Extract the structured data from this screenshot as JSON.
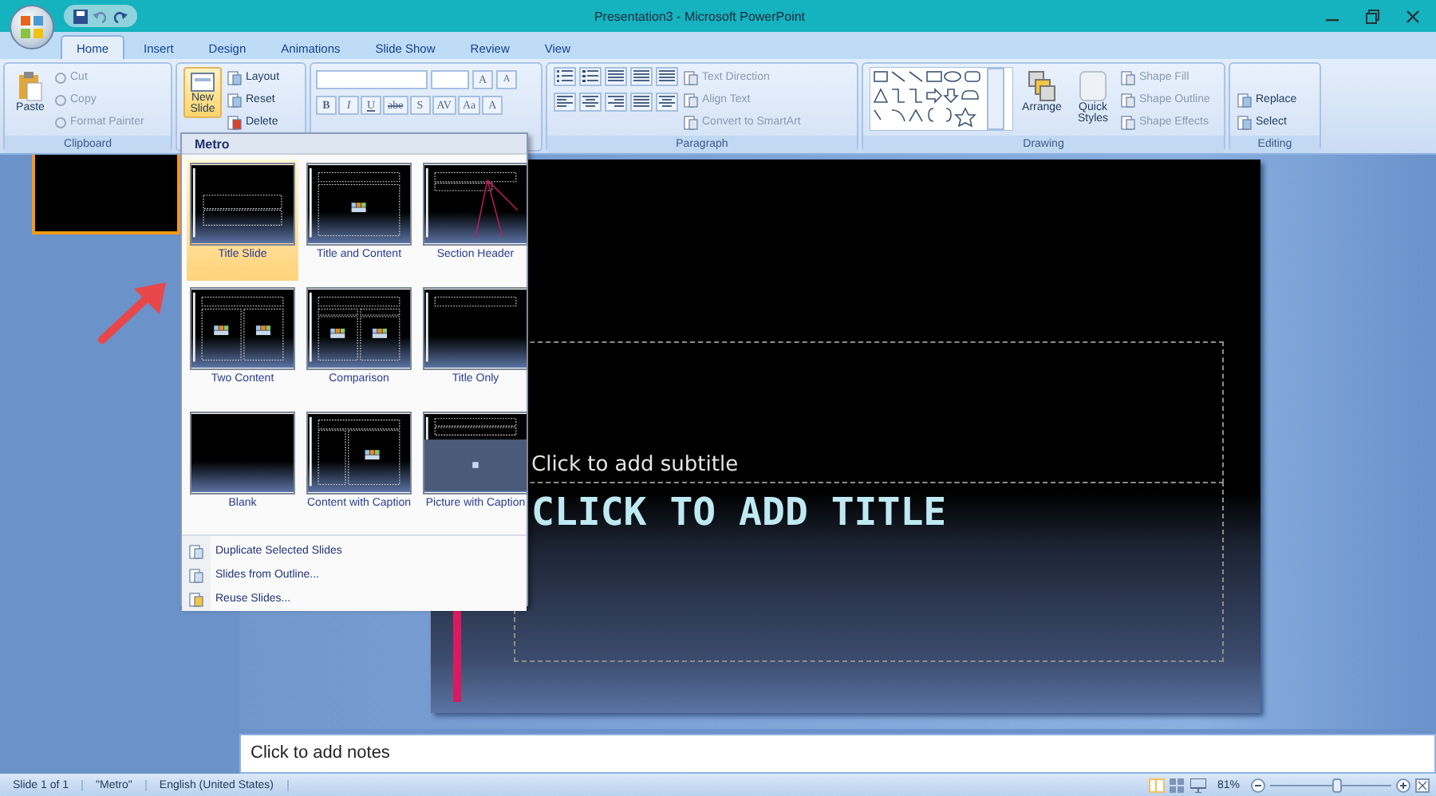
{
  "window": {
    "title": "Presentation3 - Microsoft PowerPoint"
  },
  "tabs": [
    {
      "label": "Home",
      "selected": true
    },
    {
      "label": "Insert",
      "selected": false
    },
    {
      "label": "Design",
      "selected": false
    },
    {
      "label": "Animations",
      "selected": false
    },
    {
      "label": "Slide Show",
      "selected": false
    },
    {
      "label": "Review",
      "selected": false
    },
    {
      "label": "View",
      "selected": false
    }
  ],
  "ribbon": {
    "clipboard": {
      "label": "Clipboard",
      "paste": "Paste",
      "items": [
        "Cut",
        "Copy",
        "Format Painter"
      ]
    },
    "slides": {
      "new_slide": "New Slide",
      "items": [
        "Layout",
        "Reset",
        "Delete"
      ]
    },
    "font": {
      "grow": "A",
      "shrink": "A",
      "format_buttons": [
        "B",
        "I",
        "U",
        "abe",
        "S",
        "AV",
        "Aa",
        "A"
      ]
    },
    "paragraph": {
      "label": "Paragraph",
      "items": [
        "Text Direction",
        "Align Text",
        "Convert to SmartArt"
      ]
    },
    "drawing": {
      "label": "Drawing",
      "arrange": "Arrange",
      "quick_styles": "Quick Styles",
      "items": [
        "Shape Fill",
        "Shape Outline",
        "Shape Effects"
      ]
    },
    "editing": {
      "label": "Editing",
      "items": [
        "Replace",
        "Select"
      ]
    }
  },
  "slide": {
    "subtitle": "Click to add subtitle",
    "title": "CLICK TO ADD TITLE"
  },
  "notes": {
    "text": "Click to add notes"
  },
  "layout_menu": {
    "theme": "Metro",
    "layouts": [
      {
        "label": "Title Slide",
        "kind": "title",
        "selected": true
      },
      {
        "label": "Title and Content",
        "kind": "content",
        "selected": false
      },
      {
        "label": "Section Header",
        "kind": "section",
        "selected": false
      },
      {
        "label": "Two Content",
        "kind": "two",
        "selected": false
      },
      {
        "label": "Comparison",
        "kind": "comparison",
        "selected": false
      },
      {
        "label": "Title Only",
        "kind": "title_only",
        "selected": false
      },
      {
        "label": "Blank",
        "kind": "blank",
        "selected": false
      },
      {
        "label": "Content with Caption",
        "kind": "content_caption",
        "selected": false
      },
      {
        "label": "Picture with Caption",
        "kind": "picture_caption",
        "selected": false
      }
    ],
    "commands": [
      "Duplicate Selected Slides",
      "Slides from Outline...",
      "Reuse Slides..."
    ]
  },
  "status_bar": {
    "items": [
      "Slide 1 of 1",
      "\"Metro\"",
      "English (United States)"
    ],
    "zoom": "81%",
    "zoom_slider": {
      "level": 0.55
    }
  }
}
